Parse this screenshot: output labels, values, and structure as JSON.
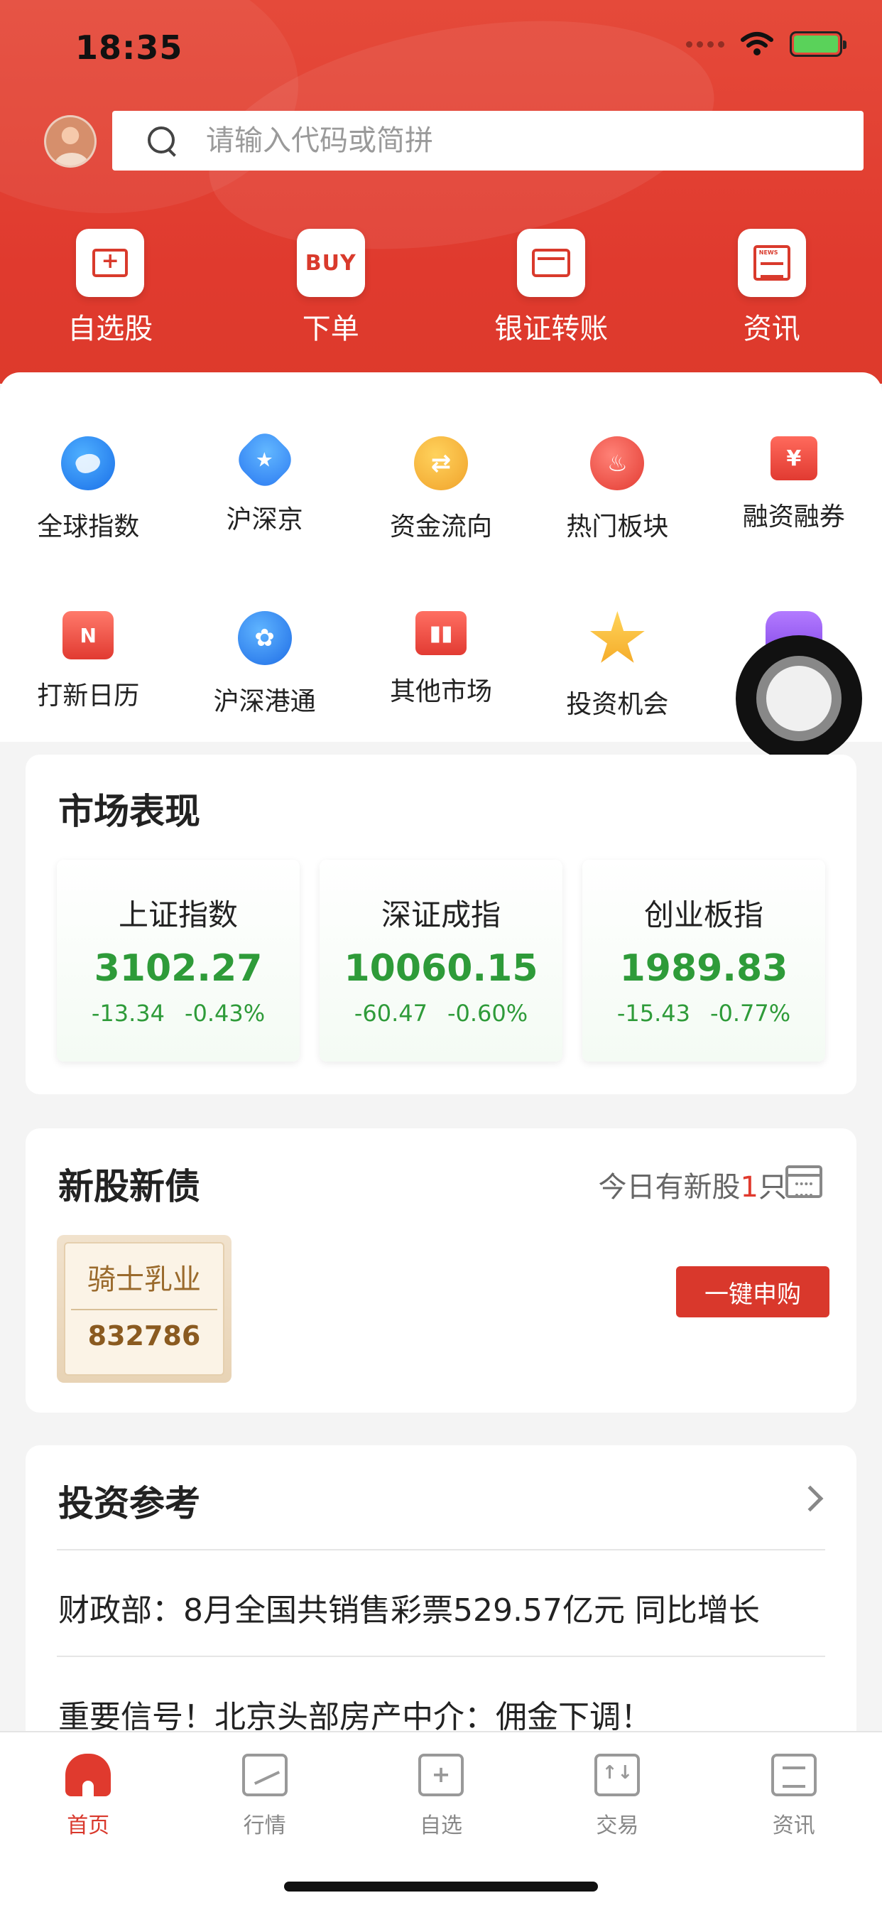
{
  "status_bar": {
    "time": "18:35"
  },
  "search": {
    "placeholder": "请输入代码或简拼"
  },
  "quick_actions": [
    {
      "label": "自选股",
      "icon": "folder-plus-icon"
    },
    {
      "label": "下单",
      "icon": "buy-icon",
      "icon_text": "BUY"
    },
    {
      "label": "银证转账",
      "icon": "card-icon"
    },
    {
      "label": "资讯",
      "icon": "news-icon"
    }
  ],
  "grid": {
    "row1": [
      {
        "label": "全球指数",
        "icon": "globe-icon"
      },
      {
        "label": "沪深京",
        "icon": "star-icon"
      },
      {
        "label": "资金流向",
        "icon": "flow-icon"
      },
      {
        "label": "热门板块",
        "icon": "fire-icon"
      },
      {
        "label": "融资融券",
        "icon": "yuan-icon"
      }
    ],
    "row2": [
      {
        "label": "打新日历",
        "icon": "calendar-icon"
      },
      {
        "label": "沪深港通",
        "icon": "bauhinia-icon"
      },
      {
        "label": "其他市场",
        "icon": "bar-chart-icon"
      },
      {
        "label": "投资机会",
        "icon": "star-chart-icon"
      },
      {
        "label": "",
        "icon": "purple-icon"
      }
    ]
  },
  "market": {
    "title": "市场表现",
    "indices": [
      {
        "name": "上证指数",
        "value": "3102.27",
        "change": "-13.34",
        "pct": "-0.43%"
      },
      {
        "name": "深证成指",
        "value": "10060.15",
        "change": "-60.47",
        "pct": "-0.60%"
      },
      {
        "name": "创业板指",
        "value": "1989.83",
        "change": "-15.43",
        "pct": "-0.77%"
      }
    ],
    "down_color": "#2e9b39"
  },
  "new_stock": {
    "title": "新股新债",
    "note_prefix": "今日有新股",
    "note_count": "1",
    "note_suffix": "只",
    "stock_name": "骑士乳业",
    "stock_code": "832786",
    "apply_label": "一键申购"
  },
  "invest_ref": {
    "title": "投资参考",
    "items": [
      "财政部：8月全国共销售彩票529.57亿元 同比增长",
      "重要信号！北京头部房产中介：佣金下调！"
    ]
  },
  "tabbar": [
    {
      "label": "首页",
      "active": true
    },
    {
      "label": "行情",
      "active": false
    },
    {
      "label": "自选",
      "active": false
    },
    {
      "label": "交易",
      "active": false
    },
    {
      "label": "资讯",
      "active": false
    }
  ],
  "colors": {
    "brand": "#e03a2e",
    "button": "#d9382c"
  }
}
